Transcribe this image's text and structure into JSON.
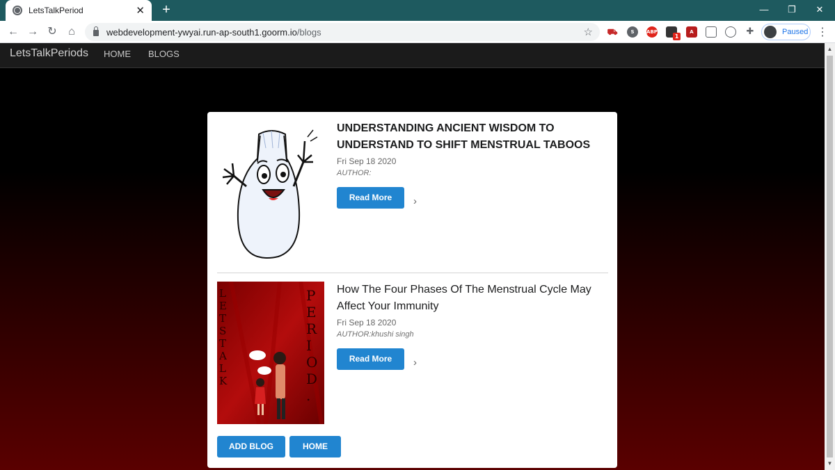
{
  "browser": {
    "tab_title": "LetsTalkPeriod",
    "new_tab_icon": "plus-icon",
    "url_host": "webdevelopment-ywyai.run-ap-south1.goorm.io",
    "url_path": "/blogs",
    "profile_status": "Paused",
    "window_controls": {
      "minimize": "—",
      "restore": "❐",
      "close": "✕"
    },
    "nav": {
      "back": "←",
      "forward": "→",
      "reload": "↻",
      "home": "⌂"
    },
    "extensions": [
      {
        "name": "abp",
        "label": "ABP",
        "color": "#e0251b"
      },
      {
        "name": "badge",
        "label": "1",
        "color": "#333333"
      }
    ]
  },
  "site": {
    "brand": "LetsTalkPeriods",
    "nav": {
      "home": "HOME",
      "blogs": "BLOGS"
    }
  },
  "blogs": [
    {
      "title": "UNDERSTANDING ANCIENT WISDOM TO UNDERSTAND TO SHIFT MENSTRUAL TABOOS",
      "date": "Fri Sep 18 2020",
      "author": "AUTHOR:",
      "read_more": "Read More",
      "image": "cartoon-pad-image"
    },
    {
      "title": "How The Four Phases Of The Menstrual Cycle May Affect Your Immunity",
      "date": "Fri Sep 18 2020",
      "author": "AUTHOR:khushi singh",
      "read_more": "Read More",
      "image": "lets-talk-period-poster",
      "poster_left": "LETS TALK",
      "poster_right": "PERIOD."
    }
  ],
  "actions": {
    "add_blog": "ADD BLOG",
    "home": "HOME"
  }
}
